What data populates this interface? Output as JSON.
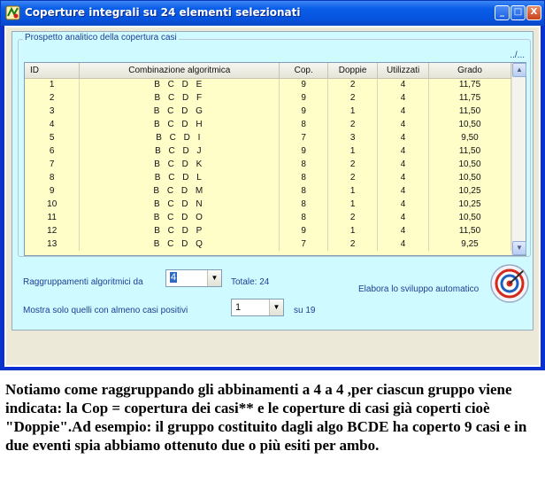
{
  "window": {
    "title": "Coperture integrali su 24 elementi selezionati",
    "controls": [
      "_",
      "□",
      "X"
    ]
  },
  "panel": {
    "group_title": "Prospetto analitico della copertura casi",
    "more_link": "../..."
  },
  "grid": {
    "columns": [
      "ID",
      "Combinazione algoritmica",
      "Cop.",
      "Doppie",
      "Utilizzati",
      "Grado"
    ],
    "rows": [
      [
        "1",
        "B C D E",
        "9",
        "2",
        "4",
        "11,75"
      ],
      [
        "2",
        "B C D F",
        "9",
        "2",
        "4",
        "11,75"
      ],
      [
        "3",
        "B C D G",
        "9",
        "1",
        "4",
        "11,50"
      ],
      [
        "4",
        "B C D H",
        "8",
        "2",
        "4",
        "10,50"
      ],
      [
        "5",
        "B C D I",
        "7",
        "3",
        "4",
        "9,50"
      ],
      [
        "6",
        "B C D J",
        "9",
        "1",
        "4",
        "11,50"
      ],
      [
        "7",
        "B C D K",
        "8",
        "2",
        "4",
        "10,50"
      ],
      [
        "8",
        "B C D L",
        "8",
        "2",
        "4",
        "10,50"
      ],
      [
        "9",
        "B C D M",
        "8",
        "1",
        "4",
        "10,25"
      ],
      [
        "10",
        "B C D N",
        "8",
        "1",
        "4",
        "10,25"
      ],
      [
        "11",
        "B C D O",
        "8",
        "2",
        "4",
        "10,50"
      ],
      [
        "12",
        "B C D P",
        "9",
        "1",
        "4",
        "11,50"
      ],
      [
        "13",
        "B C D Q",
        "7",
        "2",
        "4",
        "9,25"
      ]
    ]
  },
  "controls": {
    "raggruppamenti_label": "Raggruppamenti algoritmici da",
    "raggruppamenti_value": "4",
    "totale_label": "Totale: 24",
    "mostra_label": "Mostra solo quelli con almeno casi positivi",
    "mostra_value": "1",
    "su_label": "su 19",
    "elabora_label": "Elabora lo sviluppo automatico"
  },
  "caption": "Notiamo come raggruppando gli abbinamenti a 4 a 4 ,per ciascun gruppo viene indicata: la Cop = copertura dei casi** e le coperture di casi già coperti cioè \"Doppie\".Ad esempio: il gruppo costituito dagli algo BCDE ha coperto 9 casi e in due eventi spia abbiamo ottenuto due o più esiti per ambo."
}
